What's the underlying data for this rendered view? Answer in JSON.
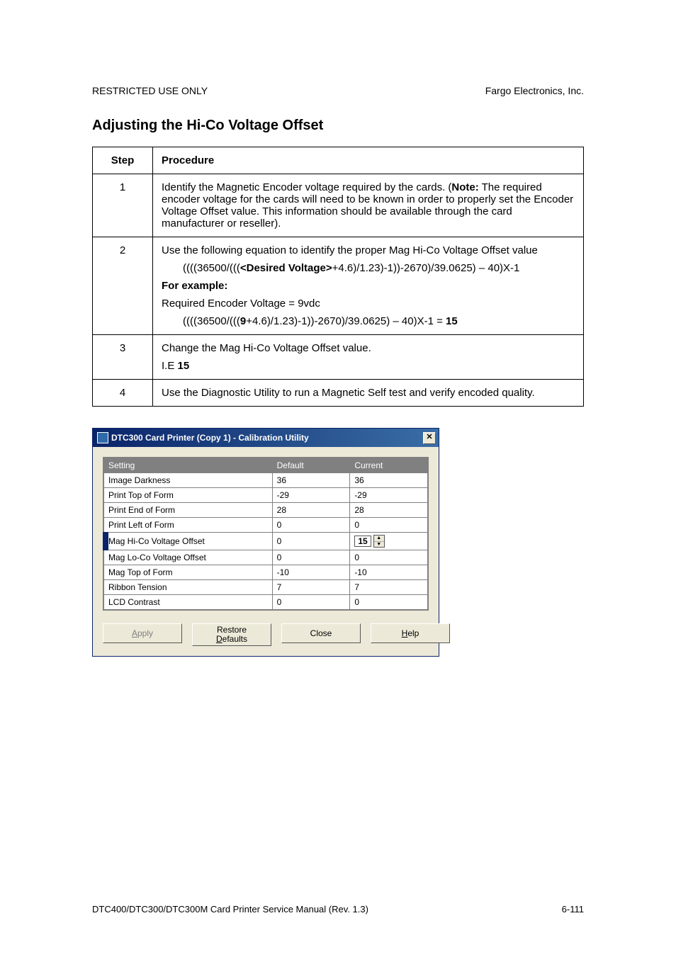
{
  "header": {
    "left": "RESTRICTED USE ONLY",
    "right": "Fargo Electronics, Inc."
  },
  "section_title": "Adjusting the Hi-Co Voltage Offset",
  "table": {
    "head": {
      "step": "Step",
      "proc": "Procedure"
    },
    "rows": {
      "r1": {
        "num": "1",
        "text": "Identify the Magnetic Encoder voltage required by the cards. (",
        "note_label": "Note:",
        "text2": "  The required encoder voltage for the cards will need to be known in order to properly set the Encoder Voltage Offset value. This information should be available through the card manufacturer or reseller)."
      },
      "r2": {
        "num": "2",
        "line1": "Use the following equation to identify the proper Mag Hi-Co Voltage Offset value",
        "eq1a": "((((36500/(((",
        "eq1bold": "<Desired Voltage>",
        "eq1b": "+4.6)/1.23)-1))-2670)/39.0625) – 40)X-1",
        "for_example": "For example:",
        "line3": "Required Encoder Voltage = 9vdc",
        "eq2a": "((((36500/(((",
        "eq2bold1": "9",
        "eq2mid": "+4.6)/1.23)-1))-2670)/39.0625) – 40)X-1 = ",
        "eq2bold2": "15"
      },
      "r3": {
        "num": "3",
        "line1": "Change the Mag Hi-Co Voltage Offset value.",
        "line2a": "I.E ",
        "line2b": "15"
      },
      "r4": {
        "num": "4",
        "text": "Use the Diagnostic Utility to run a Magnetic Self test and verify encoded quality."
      }
    }
  },
  "dialog": {
    "title": "DTC300 Card Printer (Copy 1) - Calibration Utility",
    "cols": {
      "setting": "Setting",
      "default": "Default",
      "current": "Current"
    },
    "rows": [
      {
        "name": "Image Darkness",
        "def": "36",
        "cur": "36"
      },
      {
        "name": "Print Top of Form",
        "def": "-29",
        "cur": "-29"
      },
      {
        "name": "Print End of Form",
        "def": "28",
        "cur": "28"
      },
      {
        "name": "Print Left of Form",
        "def": "0",
        "cur": "0"
      },
      {
        "name": "Mag Hi-Co Voltage Offset",
        "def": "0",
        "cur": "15",
        "spinner": true
      },
      {
        "name": "Mag Lo-Co Voltage Offset",
        "def": "0",
        "cur": "0"
      },
      {
        "name": "Mag Top of Form",
        "def": "-10",
        "cur": "-10"
      },
      {
        "name": "Ribbon Tension",
        "def": "7",
        "cur": "7"
      },
      {
        "name": "LCD Contrast",
        "def": "0",
        "cur": "0"
      }
    ],
    "buttons": {
      "apply_pre": "A",
      "apply_u": "",
      "apply_post": "pply",
      "restore1": "Restore",
      "restore2_pre": "",
      "restore2_u": "D",
      "restore2_post": "efaults",
      "close": "Close",
      "help_u": "H",
      "help_post": "elp"
    }
  },
  "footer": {
    "left": "DTC400/DTC300/DTC300M Card Printer Service Manual (Rev. 1.3)",
    "right": "6-111"
  }
}
